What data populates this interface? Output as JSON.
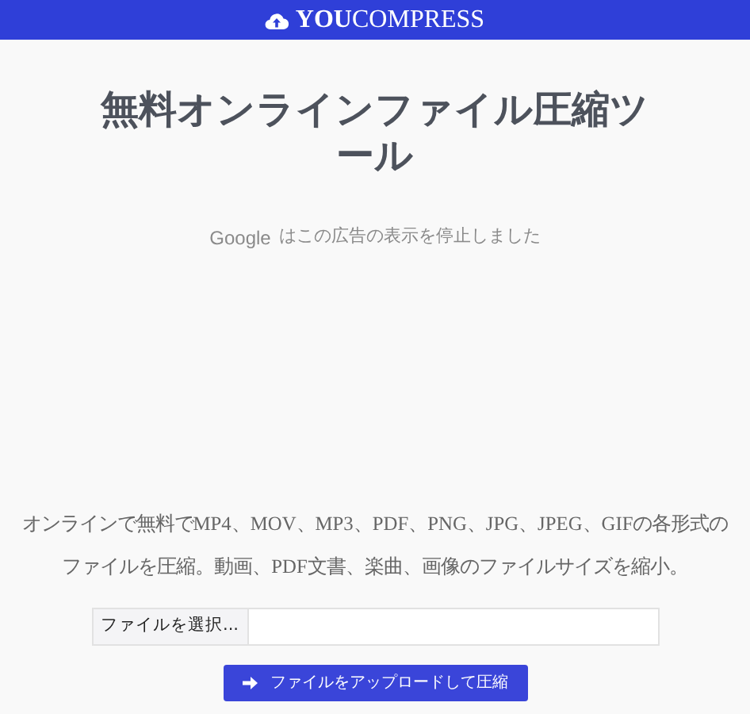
{
  "header": {
    "logo": "**YOU**COMPRESS"
  },
  "title": "無料オンラインファイル圧縮ツール",
  "ad_notice": {
    "brand": "Google",
    "text": "はこの広告の表示を停止しました"
  },
  "description": "オンラインで無料でMP4、MOV、MP3、PDF、PNG、JPG、JPEG、GIFの各形式のファイルを圧縮。動画、PDF文書、楽曲、画像のファイルサイズを縮小。",
  "file_input": {
    "button": "ファイルを選択..."
  },
  "upload_button": "ファイルをアップロードして圧縮"
}
